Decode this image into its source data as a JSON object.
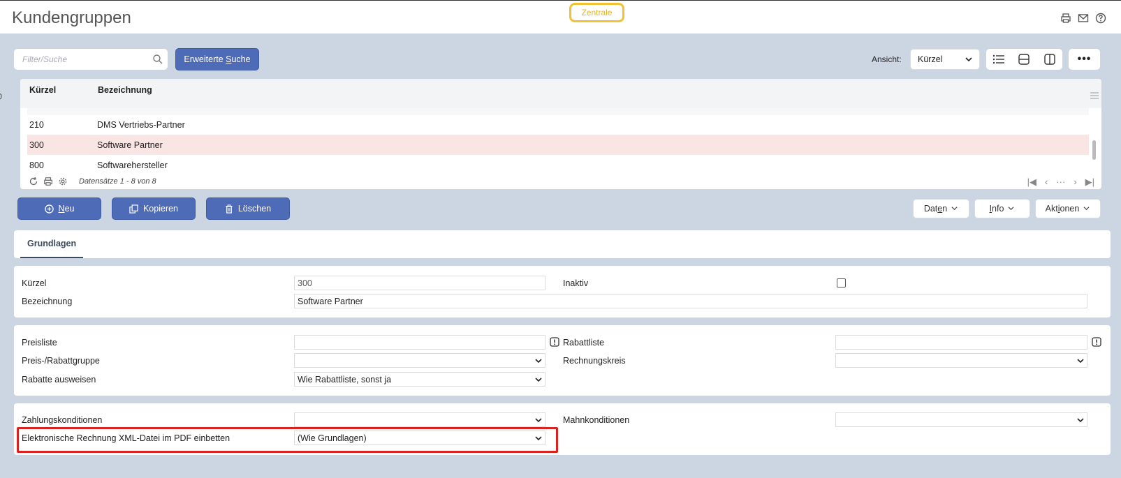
{
  "header": {
    "title": "Kundengruppen",
    "badge": "Zentrale"
  },
  "toolbar": {
    "search_placeholder": "Filter/Suche",
    "advanced_search": {
      "pre": "Erweiterte ",
      "accel": "S",
      "post": "uche"
    },
    "view_label": "Ansicht:",
    "view_value": "Kürzel",
    "more": "•••"
  },
  "grid": {
    "columns": [
      "Kürzel",
      "Bezeichnung"
    ],
    "rows": [
      {
        "code": "210",
        "name": "DMS Vertriebs-Partner"
      },
      {
        "code": "300",
        "name": "Software Partner"
      },
      {
        "code": "800",
        "name": "Softwarehersteller"
      }
    ],
    "records": "Datensätze 1 - 8 von 8",
    "pager": {
      "first": "|◀",
      "prev": "‹",
      "dots": "···",
      "next": "›",
      "last": "▶|"
    }
  },
  "actions": {
    "new": {
      "accel": "N",
      "rest": "eu"
    },
    "copy": "Kopieren",
    "delete": "Löschen",
    "data": {
      "pre": "Dat",
      "accel": "e",
      "post": "n"
    },
    "info": {
      "accel": "I",
      "rest": "nfo"
    },
    "actions": {
      "pre": "Akt",
      "accel": "i",
      "post": "onen"
    }
  },
  "tabs": [
    "Grundlagen"
  ],
  "form": {
    "kuerzel_label": "Kürzel",
    "kuerzel_value": "300",
    "inaktiv_label": "Inaktiv",
    "bezeichnung_label": "Bezeichnung",
    "bezeichnung_value": "Software Partner",
    "preisliste_label": "Preisliste",
    "rabattliste_label": "Rabattliste",
    "preisrabatt_label": "Preis-/Rabattgruppe",
    "rechnungskreis_label": "Rechnungskreis",
    "rabatte_label": "Rabatte ausweisen",
    "rabatte_value": "Wie Rabattliste, sonst ja",
    "zahlung_label": "Zahlungskonditionen",
    "mahn_label": "Mahnkonditionen",
    "erechnung_label": "Elektronische Rechnung XML-Datei im PDF einbetten",
    "erechnung_value": "(Wie Grundlagen)"
  },
  "colors": {
    "primary": "#4e6bb8",
    "selected_row": "#f9e5e3",
    "highlight": "#d9231f",
    "badge": "#f2c230",
    "background": "#ccd6e3"
  }
}
